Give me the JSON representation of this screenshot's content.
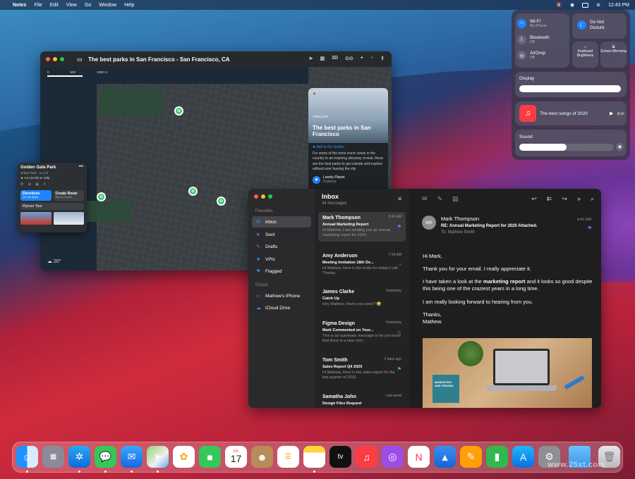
{
  "menubar": {
    "app": "Notes",
    "items": [
      "File",
      "Edit",
      "View",
      "Go",
      "Window",
      "Help"
    ],
    "time": "12:43 PM"
  },
  "control_center": {
    "wifi": {
      "label": "Wi-Fi",
      "sub": "My iPhone"
    },
    "bluetooth": {
      "label": "Bluetooth",
      "sub": "Off"
    },
    "airdrop": {
      "label": "AirDrop",
      "sub": "Off"
    },
    "dnd": {
      "label": "Do Not Disturb"
    },
    "keyboard": {
      "label": "Keyboard Brightness"
    },
    "mirroring": {
      "label": "Screen Mirroring"
    },
    "display": {
      "label": "Display",
      "level": 0.97
    },
    "now_playing": {
      "label": "The best songs of 2020"
    },
    "sound": {
      "label": "Sound",
      "level": 0.5
    }
  },
  "maps": {
    "title": "The best parks in San Francisco - San Francisco, CA",
    "tools": [
      "3D"
    ],
    "scale": [
      "0",
      "500",
      "1000 m"
    ],
    "temp": "20°",
    "guide": {
      "source": "THRILLIST",
      "title": "The best parks in San Francisco",
      "add": "Add to My Guides",
      "desc": "For some of the most iconic views in the country to an inspiring alleyway revival, these are the best parks to get outside and explore without ever leaving the city",
      "publisher": "Lonely Planet",
      "publisher_sub": "9 places"
    },
    "park_card": {
      "name": "Golden Gate Park",
      "type": "Urban Park · 5.4 mi",
      "rating": "★ 4.6 (1179) on Yelp",
      "directions": "Directions",
      "directions_sub": "14 min drive",
      "route": "Create Route",
      "route_sub": "Add to Route",
      "flyover": "Flyover Tour"
    }
  },
  "mail": {
    "sidebar": {
      "favorites_label": "Favorites",
      "favorites": [
        {
          "icon": "✉",
          "label": "Inbox"
        },
        {
          "icon": "➤",
          "label": "Sent"
        },
        {
          "icon": "✎",
          "label": "Drafts"
        },
        {
          "icon": "★",
          "label": "VPIs"
        },
        {
          "icon": "⚑",
          "label": "Flagged"
        }
      ],
      "icloud_label": "iCloud",
      "icloud": [
        {
          "icon": "▭",
          "label": "Mathew's iPhone"
        },
        {
          "icon": "☁",
          "label": "iCloud Drive"
        }
      ]
    },
    "list_title": "Inbox",
    "list_count": "34 messages",
    "messages": [
      {
        "from": "Mark Thompson",
        "date": "9:41 AM",
        "subject": "Annual Marketing Report",
        "preview": "Hi Mathew, I am sending you an annual marketing report for 2020..."
      },
      {
        "from": "Amy Anderson",
        "date": "7:29 AM",
        "subject": "Meeting Invitation 18th De...",
        "preview": "Hi Mathew, Here is the invite for today's call. Thanks."
      },
      {
        "from": "James Clarke",
        "date": "Yesterday",
        "subject": "Catch Up",
        "preview": "Hey Mathew, How's you been? 😀"
      },
      {
        "from": "Figma Design",
        "date": "Yesterday",
        "subject": "Mark Commented on Your...",
        "preview": "This is an automatic message to let you know that there is a new com..."
      },
      {
        "from": "Tom Smith",
        "date": "2 days ago",
        "subject": "Sales Report Q4 2020",
        "preview": "Hi Mathew, Here is the sales report for the last quarter of 2020."
      },
      {
        "from": "Samatha John",
        "date": "Last week",
        "subject": "Design Files Request",
        "preview": ""
      }
    ],
    "reader": {
      "initials": "MK",
      "from": "Mark Thompson",
      "date": "9:41 AM",
      "subject": "RE: Annual Marketing Report for 2020 Attached.",
      "to_label": "To:",
      "to": "Mathew Smith",
      "greeting": "Hi Mark,",
      "p1": "Thank you for your email. I really appreciate it.",
      "p2_a": "I have taken a look at the ",
      "p2_b": "marketing report",
      "p2_c": " and it looks so good despite this being one of the craziest years in a long time.",
      "p3": "I am really looking forward to hearing from you.",
      "signoff": "Thanks,",
      "name": "Mathew.",
      "book_title": "MARKETING AND PRICING"
    }
  },
  "dock": {
    "apps": [
      "finder-icon",
      "launchpad-icon",
      "safari-icon",
      "messages-icon",
      "mail-icon",
      "maps-icon",
      "photos-icon",
      "facetime-icon",
      "calendar-icon",
      "contacts-icon",
      "reminders-icon",
      "notes-icon",
      "tv-icon",
      "music-icon",
      "podcasts-icon",
      "news-icon",
      "keynote-icon",
      "pages-icon",
      "numbers-icon",
      "appstore-icon",
      "settings-icon",
      "folder-icon",
      "trash-icon"
    ],
    "calendar_month": "JUL",
    "calendar_day": "17",
    "tv": "tv"
  },
  "watermark": "www.25xt.com"
}
